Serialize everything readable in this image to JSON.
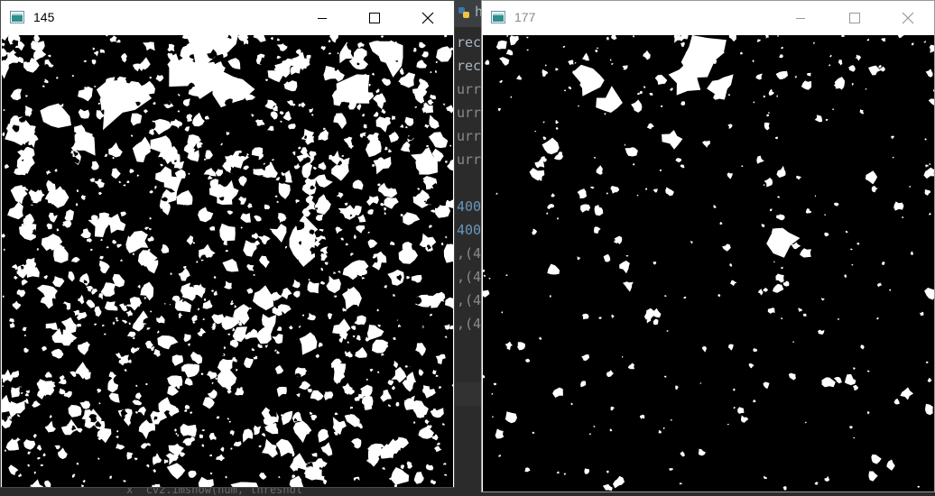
{
  "ide": {
    "tab_label": "h",
    "code_lines": [
      {
        "text": "rec",
        "cls": ""
      },
      {
        "text": "rec",
        "cls": ""
      },
      {
        "text": "urr",
        "cls": "dim"
      },
      {
        "text": "urr",
        "cls": "dim"
      },
      {
        "text": "urr",
        "cls": "dim"
      },
      {
        "text": "urr",
        "cls": "dim"
      },
      {
        "text": "",
        "cls": ""
      },
      {
        "text": "400",
        "cls": "num"
      },
      {
        "text": "400",
        "cls": "num"
      },
      {
        "text": ",(4",
        "cls": "dim"
      },
      {
        "text": ",(4",
        "cls": "dim"
      },
      {
        "text": ",(4",
        "cls": "dim"
      },
      {
        "text": ",(4",
        "cls": "dim"
      }
    ],
    "bottom_text": "x  cv2.imshow(num, threshol"
  },
  "windows": [
    {
      "title": "145",
      "icons": {
        "app": "image-window-icon",
        "minimize": "minimize-icon",
        "maximize": "maximize-icon",
        "close": "close-icon"
      },
      "image_desc": "binary-threshold-image-dense"
    },
    {
      "title": "177",
      "icons": {
        "app": "image-window-icon",
        "minimize": "minimize-icon",
        "maximize": "maximize-icon",
        "close": "close-icon"
      },
      "image_desc": "binary-threshold-image-sparse"
    }
  ],
  "colors": {
    "foreground": "#ffffff",
    "background": "#000000",
    "ide_bg": "#2b2b2b",
    "ide_number": "#6897bb",
    "ide_text": "#a9b7c6"
  }
}
